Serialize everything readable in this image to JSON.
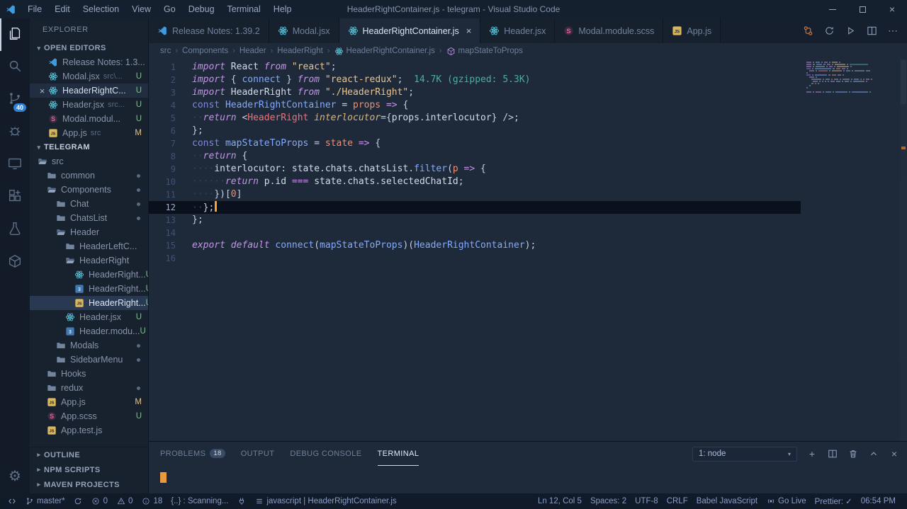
{
  "window": {
    "title": "HeaderRightContainer.js - telegram - Visual Studio Code",
    "controls": [
      "minimize",
      "restore",
      "close"
    ]
  },
  "menu": {
    "items": [
      "File",
      "Edit",
      "Selection",
      "View",
      "Go",
      "Debug",
      "Terminal",
      "Help"
    ]
  },
  "activity_bar": {
    "items": [
      {
        "name": "explorer",
        "active": true
      },
      {
        "name": "search"
      },
      {
        "name": "source-control",
        "badge": "40"
      },
      {
        "name": "debug"
      },
      {
        "name": "remote"
      },
      {
        "name": "extensions"
      },
      {
        "name": "test"
      },
      {
        "name": "docker"
      }
    ],
    "bottom": [
      {
        "name": "settings"
      }
    ]
  },
  "sidebar": {
    "title": "EXPLORER",
    "open_editors": {
      "label": "OPEN EDITORS",
      "items": [
        {
          "icon": "vscode",
          "name": "Release Notes: 1.3...",
          "path": "",
          "badge": ""
        },
        {
          "icon": "react",
          "name": "Modal.jsx",
          "path": "src\\...",
          "badge": "U"
        },
        {
          "icon": "react",
          "name": "HeaderRightC...",
          "path": "",
          "badge": "U",
          "active": true
        },
        {
          "icon": "react",
          "name": "Header.jsx",
          "path": "src...",
          "badge": "U"
        },
        {
          "icon": "scss",
          "name": "Modal.modul...",
          "path": "",
          "badge": "U"
        },
        {
          "icon": "js",
          "name": "App.js",
          "path": "src",
          "badge": "M"
        }
      ]
    },
    "tree": {
      "label": "TELEGRAM",
      "items": [
        {
          "icon": "folder-open",
          "name": "src",
          "level": 0
        },
        {
          "icon": "folder",
          "name": "common",
          "level": 1,
          "dot": true
        },
        {
          "icon": "folder-open",
          "name": "Components",
          "level": 1,
          "dot": true
        },
        {
          "icon": "folder",
          "name": "Chat",
          "level": 2,
          "dot": true
        },
        {
          "icon": "folder",
          "name": "ChatsList",
          "level": 2,
          "dot": true
        },
        {
          "icon": "folder-open",
          "name": "Header",
          "level": 2
        },
        {
          "icon": "folder",
          "name": "HeaderLeftC...",
          "level": 3
        },
        {
          "icon": "folder-open",
          "name": "HeaderRight",
          "level": 3
        },
        {
          "icon": "react",
          "name": "HeaderRight...",
          "level": 4,
          "badge": "U"
        },
        {
          "icon": "module",
          "name": "HeaderRight...",
          "level": 4,
          "badge": "U"
        },
        {
          "icon": "js",
          "name": "HeaderRight...",
          "level": 4,
          "badge": "U",
          "selected": true
        },
        {
          "icon": "react",
          "name": "Header.jsx",
          "level": 3,
          "badge": "U"
        },
        {
          "icon": "module",
          "name": "Header.modu...",
          "level": 3,
          "badge": "U"
        },
        {
          "icon": "folder",
          "name": "Modals",
          "level": 2,
          "dot": true
        },
        {
          "icon": "folder",
          "name": "SidebarMenu",
          "level": 2,
          "dot": true
        },
        {
          "icon": "folder",
          "name": "Hooks",
          "level": 1
        },
        {
          "icon": "folder",
          "name": "redux",
          "level": 1,
          "dot": true
        },
        {
          "icon": "js",
          "name": "App.js",
          "level": 1,
          "badge": "M"
        },
        {
          "icon": "scss",
          "name": "App.scss",
          "level": 1,
          "badge": "U"
        },
        {
          "icon": "js",
          "name": "App.test.js",
          "level": 1
        }
      ]
    },
    "sections": [
      {
        "label": "OUTLINE"
      },
      {
        "label": "NPM SCRIPTS"
      },
      {
        "label": "MAVEN PROJECTS"
      }
    ]
  },
  "editor": {
    "tabs": [
      {
        "label": "Release Notes: 1.39.2",
        "icon": "vscode"
      },
      {
        "label": "Modal.jsx",
        "icon": "react"
      },
      {
        "label": "HeaderRightContainer.js",
        "icon": "react",
        "active": true
      },
      {
        "label": "Header.jsx",
        "icon": "react"
      },
      {
        "label": "Modal.module.scss",
        "icon": "scss"
      },
      {
        "label": "App.js",
        "icon": "js"
      }
    ],
    "actions": [
      "compare-changes",
      "refresh",
      "run",
      "split-editor",
      "more-actions"
    ],
    "breadcrumbs": [
      {
        "label": "src"
      },
      {
        "label": "Components"
      },
      {
        "label": "Header"
      },
      {
        "label": "HeaderRight"
      },
      {
        "label": "HeaderRightContainer.js",
        "icon": "react"
      },
      {
        "label": "mapStateToProps",
        "icon": "symbol-method"
      }
    ],
    "cursor": {
      "line": 12,
      "col": 5
    },
    "code": {
      "lines": [
        {
          "n": 1,
          "tokens": [
            [
              "kw",
              "import"
            ],
            [
              "t",
              " "
            ],
            [
              "v",
              "React"
            ],
            [
              "t",
              " "
            ],
            [
              "kw",
              "from"
            ],
            [
              "t",
              " "
            ],
            [
              "s",
              "\"react\""
            ],
            [
              "t",
              ";"
            ]
          ]
        },
        {
          "n": 2,
          "tokens": [
            [
              "kw",
              "import"
            ],
            [
              "t",
              " { "
            ],
            [
              "fn",
              "connect"
            ],
            [
              "t",
              " } "
            ],
            [
              "kw",
              "from"
            ],
            [
              "t",
              " "
            ],
            [
              "s",
              "\"react-redux\""
            ],
            [
              "t",
              ";"
            ],
            [
              "hint",
              "  14.7K (gzipped: 5.3K)"
            ]
          ]
        },
        {
          "n": 3,
          "tokens": [
            [
              "kw",
              "import"
            ],
            [
              "t",
              " "
            ],
            [
              "v",
              "HeaderRight"
            ],
            [
              "t",
              " "
            ],
            [
              "kw",
              "from"
            ],
            [
              "t",
              " "
            ],
            [
              "s",
              "\"./HeaderRight\""
            ],
            [
              "t",
              ";"
            ]
          ]
        },
        {
          "n": 4,
          "tokens": [
            [
              "kw2",
              "const"
            ],
            [
              "t",
              " "
            ],
            [
              "fn",
              "HeaderRightContainer"
            ],
            [
              "t",
              " = "
            ],
            [
              "n",
              "props"
            ],
            [
              "op",
              " => "
            ],
            [
              "t",
              "{"
            ]
          ]
        },
        {
          "n": 5,
          "tokens": [
            [
              "ws",
              "··"
            ],
            [
              "kw",
              "return"
            ],
            [
              "t",
              " <"
            ],
            [
              "tag",
              "HeaderRight"
            ],
            [
              "t",
              " "
            ],
            [
              "attr",
              "interlocutor"
            ],
            [
              "t",
              "={"
            ],
            [
              "v",
              "props"
            ],
            [
              "t",
              "."
            ],
            [
              "v",
              "interlocutor"
            ],
            [
              "t",
              "} />;"
            ]
          ]
        },
        {
          "n": 6,
          "tokens": [
            [
              "t",
              "};"
            ]
          ]
        },
        {
          "n": 7,
          "tokens": [
            [
              "kw2",
              "const"
            ],
            [
              "t",
              " "
            ],
            [
              "fn",
              "mapStateToProps"
            ],
            [
              "t",
              " = "
            ],
            [
              "n",
              "state"
            ],
            [
              "op",
              " => "
            ],
            [
              "t",
              "{"
            ]
          ]
        },
        {
          "n": 8,
          "tokens": [
            [
              "ws",
              "··"
            ],
            [
              "kw",
              "return"
            ],
            [
              "t",
              " {"
            ]
          ]
        },
        {
          "n": 9,
          "tokens": [
            [
              "ws",
              "····"
            ],
            [
              "v",
              "interlocutor"
            ],
            [
              "t",
              ": "
            ],
            [
              "v",
              "state"
            ],
            [
              "t",
              "."
            ],
            [
              "v",
              "chats"
            ],
            [
              "t",
              "."
            ],
            [
              "v",
              "chatsList"
            ],
            [
              "t",
              "."
            ],
            [
              "fn",
              "filter"
            ],
            [
              "t",
              "("
            ],
            [
              "n",
              "p"
            ],
            [
              "op",
              " => "
            ],
            [
              "t",
              "{"
            ]
          ]
        },
        {
          "n": 10,
          "tokens": [
            [
              "ws",
              "······"
            ],
            [
              "kw",
              "return"
            ],
            [
              "t",
              " "
            ],
            [
              "v",
              "p"
            ],
            [
              "t",
              "."
            ],
            [
              "v",
              "id"
            ],
            [
              "op",
              " === "
            ],
            [
              "v",
              "state"
            ],
            [
              "t",
              "."
            ],
            [
              "v",
              "chats"
            ],
            [
              "t",
              "."
            ],
            [
              "v",
              "selectedChatId"
            ],
            [
              "t",
              ";"
            ]
          ]
        },
        {
          "n": 11,
          "tokens": [
            [
              "ws",
              "····"
            ],
            [
              "t",
              "})["
            ],
            [
              "n",
              "0"
            ],
            [
              "t",
              "]"
            ]
          ]
        },
        {
          "n": 12,
          "tokens": [
            [
              "ws",
              "··"
            ],
            [
              "t",
              "};"
            ]
          ]
        },
        {
          "n": 13,
          "tokens": [
            [
              "t",
              "};"
            ]
          ]
        },
        {
          "n": 14,
          "tokens": []
        },
        {
          "n": 15,
          "tokens": [
            [
              "kw",
              "export"
            ],
            [
              "t",
              " "
            ],
            [
              "kw",
              "default"
            ],
            [
              "t",
              " "
            ],
            [
              "fn",
              "connect"
            ],
            [
              "t",
              "("
            ],
            [
              "fn",
              "mapStateToProps"
            ],
            [
              "t",
              ")("
            ],
            [
              "fn",
              "HeaderRightContainer"
            ],
            [
              "t",
              ");"
            ]
          ]
        },
        {
          "n": 16,
          "tokens": []
        }
      ]
    }
  },
  "panel": {
    "tabs": [
      {
        "label": "PROBLEMS",
        "badge": "18"
      },
      {
        "label": "OUTPUT"
      },
      {
        "label": "DEBUG CONSOLE"
      },
      {
        "label": "TERMINAL",
        "active": true
      }
    ],
    "terminal_select": "1: node",
    "actions": [
      "add",
      "split-terminal",
      "trash",
      "chevron-up",
      "close"
    ]
  },
  "status_bar": {
    "left": [
      {
        "name": "remote",
        "icon": "remote-indicator",
        "label": ""
      },
      {
        "name": "git-branch",
        "icon": "branch",
        "label": "master*"
      },
      {
        "name": "sync",
        "icon": "sync",
        "label": ""
      },
      {
        "name": "errors",
        "icon": "error",
        "label": "0"
      },
      {
        "name": "warnings",
        "icon": "warning",
        "label": "0"
      },
      {
        "name": "info-count",
        "icon": "info",
        "label": "18"
      },
      {
        "name": "scanning",
        "label": "{..} : Scanning..."
      },
      {
        "name": "connector",
        "icon": "plug",
        "label": ""
      },
      {
        "name": "doc-language",
        "icon": "list",
        "label": "javascript | HeaderRightContainer.js"
      }
    ],
    "right": [
      {
        "name": "cursor-position",
        "label": "Ln 12, Col 5"
      },
      {
        "name": "indentation",
        "label": "Spaces: 2"
      },
      {
        "name": "encoding",
        "label": "UTF-8"
      },
      {
        "name": "eol",
        "label": "CRLF"
      },
      {
        "name": "language-mode",
        "label": "Babel JavaScript"
      },
      {
        "name": "go-live",
        "icon": "broadcast",
        "label": "Go Live"
      },
      {
        "name": "prettier",
        "label": "Prettier: ✓"
      },
      {
        "name": "clock",
        "label": "06:54 PM"
      }
    ]
  }
}
